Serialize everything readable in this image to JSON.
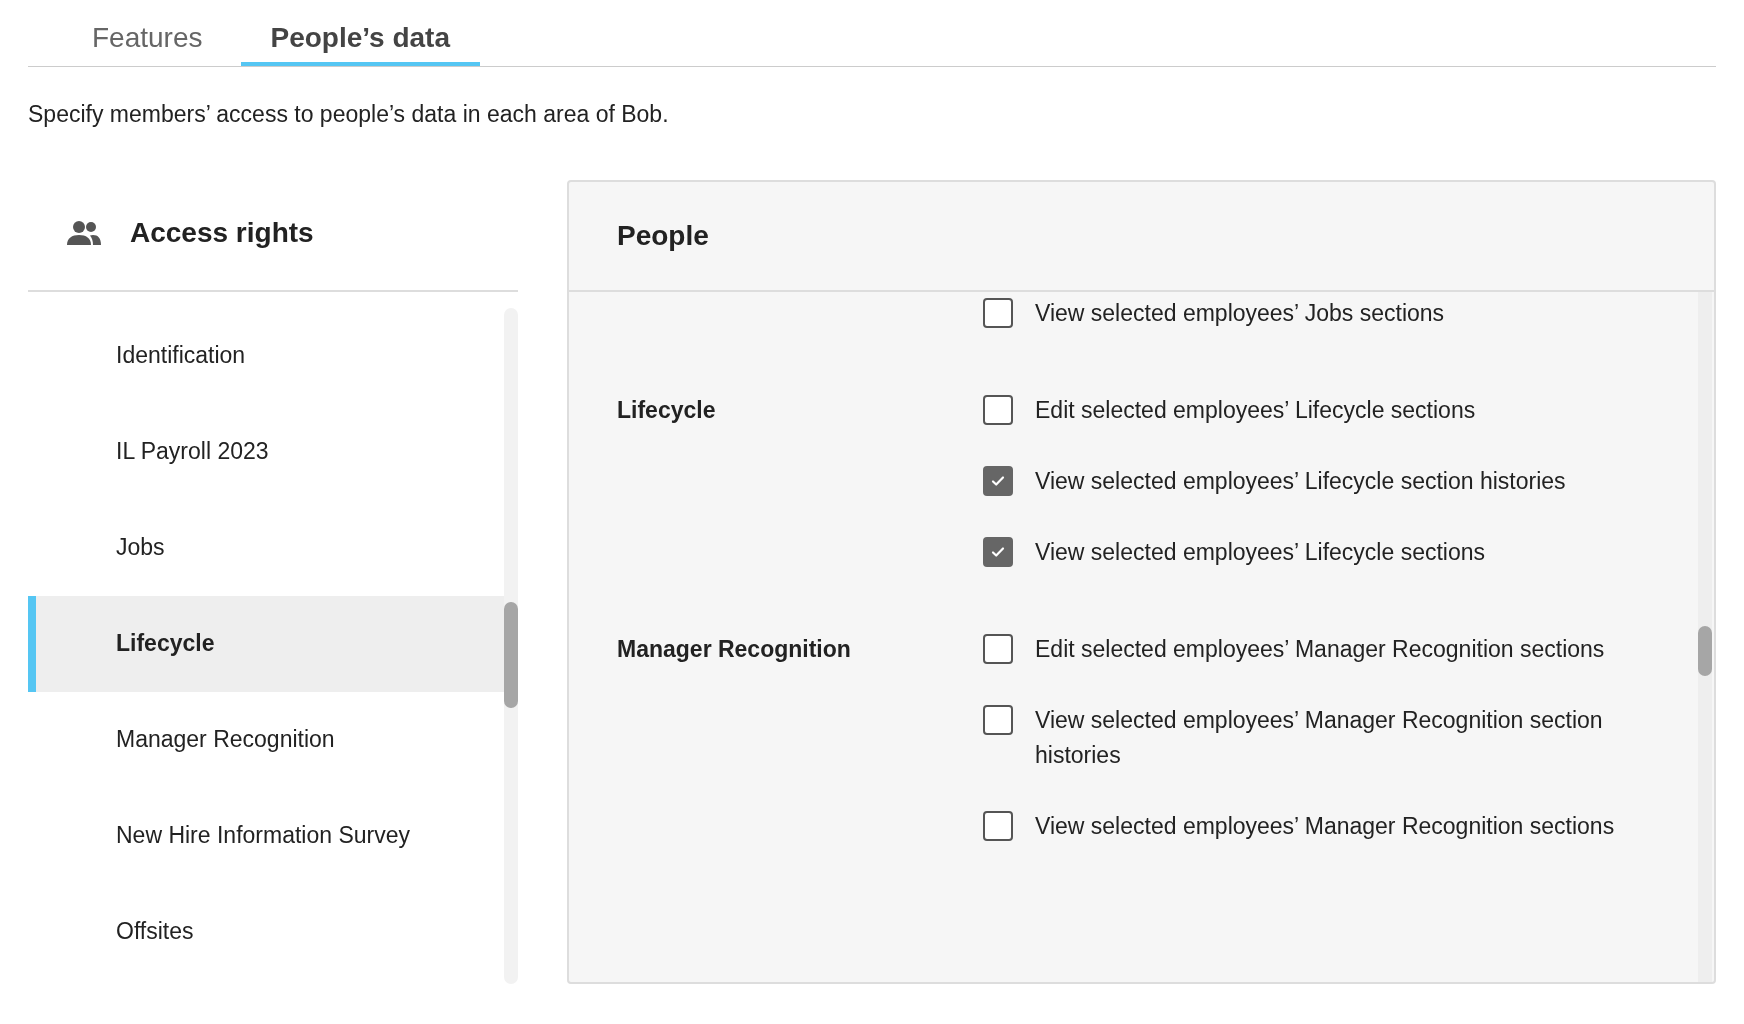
{
  "tabs": [
    {
      "label": "Features",
      "selected": false
    },
    {
      "label": "People’s data",
      "selected": true
    }
  ],
  "description": "Specify members’ access to people’s data in each area of Bob.",
  "sidebar": {
    "title": "Access rights",
    "items": [
      {
        "label": "Identification",
        "selected": false
      },
      {
        "label": "IL Payroll 2023",
        "selected": false
      },
      {
        "label": "Jobs",
        "selected": false
      },
      {
        "label": "Lifecycle",
        "selected": true
      },
      {
        "label": "Manager Recognition",
        "selected": false
      },
      {
        "label": "New Hire Information Survey",
        "selected": false
      },
      {
        "label": "Offsites",
        "selected": false
      }
    ]
  },
  "panel": {
    "title": "People",
    "groups": [
      {
        "permissions": [
          {
            "label": "View selected employees’ Jobs sections",
            "checked": false
          }
        ]
      },
      {
        "label": "Lifecycle",
        "permissions": [
          {
            "label": "Edit selected employees’ Lifecycle sections",
            "checked": false
          },
          {
            "label": "View selected employees’ Lifecycle section histories",
            "checked": true
          },
          {
            "label": "View selected employees’ Lifecycle sections",
            "checked": true
          }
        ]
      },
      {
        "label": "Manager Recognition",
        "permissions": [
          {
            "label": "Edit selected employees’ Manager Recognition sections",
            "checked": false
          },
          {
            "label": "View selected employees’ Manager Recognition section histories",
            "checked": false
          },
          {
            "label": "View selected employees’ Manager Recognition sections",
            "checked": false
          }
        ]
      }
    ]
  }
}
